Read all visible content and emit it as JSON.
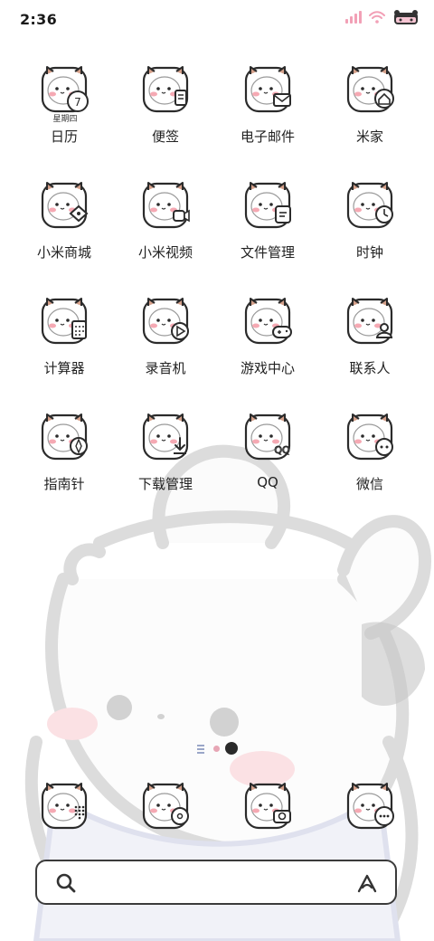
{
  "status_bar": {
    "time": "2:36",
    "icons": [
      "signal-icon",
      "wifi-icon",
      "battery-icon"
    ]
  },
  "apps": [
    {
      "label": "日历",
      "sub": "星期四",
      "day": "7",
      "badge": "calendar"
    },
    {
      "label": "便签",
      "badge": "note"
    },
    {
      "label": "电子邮件",
      "badge": "mail"
    },
    {
      "label": "米家",
      "badge": "home"
    },
    {
      "label": "小米商城",
      "badge": "store"
    },
    {
      "label": "小米视频",
      "badge": "video"
    },
    {
      "label": "文件管理",
      "badge": "file"
    },
    {
      "label": "时钟",
      "badge": "clock"
    },
    {
      "label": "计算器",
      "badge": "calculator"
    },
    {
      "label": "录音机",
      "badge": "recorder"
    },
    {
      "label": "游戏中心",
      "badge": "gamepad"
    },
    {
      "label": "联系人",
      "badge": "contacts"
    },
    {
      "label": "指南针",
      "badge": "compass"
    },
    {
      "label": "下载管理",
      "badge": "download"
    },
    {
      "label": "QQ",
      "badge": "qq"
    },
    {
      "label": "微信",
      "badge": "wechat"
    }
  ],
  "page_indicator": {
    "pages": 2,
    "current": 2
  },
  "dock": [
    {
      "name": "phone-dock-app",
      "badge": "phone"
    },
    {
      "name": "music-dock-app",
      "badge": "music"
    },
    {
      "name": "camera-dock-app",
      "badge": "camera"
    },
    {
      "name": "messages-dock-app",
      "badge": "message"
    }
  ],
  "search_bar": {
    "placeholder": ""
  },
  "colors": {
    "icon_outline": "#2b2b2b",
    "cat_ear": "#d4a08a",
    "blush": "#f5a9b3",
    "wallpaper_line": "#d9d9d9",
    "page_dot_active": "#2a2a2a",
    "page_dot_inactive": "#e7a6b5"
  }
}
